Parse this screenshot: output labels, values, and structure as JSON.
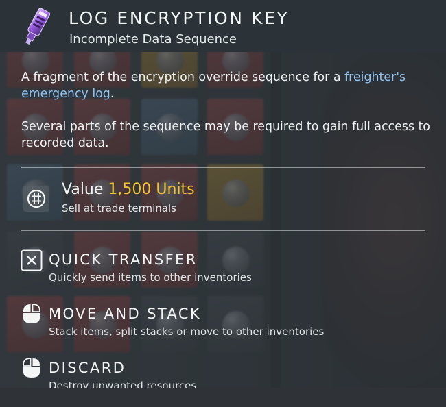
{
  "item": {
    "title": "LOG ENCRYPTION KEY",
    "subtitle": "Incomplete Data Sequence",
    "icon": "encryption-key-icon"
  },
  "description": {
    "p1_text": "A fragment of the encryption override sequence for a ",
    "p1_link": "freighter's emergency log",
    "p1_end": ".",
    "p2": "Several parts of the sequence may be required to gain full access to recorded data."
  },
  "value": {
    "label": "Value",
    "amount": "1,500 Units",
    "sub": "Sell at trade terminals",
    "icon": "units-currency-icon"
  },
  "actions": [
    {
      "title": "QUICK TRANSFER",
      "sub": "Quickly send items to other inventories",
      "icon": "x-key-icon"
    },
    {
      "title": "MOVE AND STACK",
      "sub": "Stack items, split stacks or move to other inventories",
      "icon": "left-mouse-button-icon"
    },
    {
      "title": "DISCARD",
      "sub": "Destroy unwanted resources",
      "icon": "right-mouse-button-icon"
    }
  ],
  "colors": {
    "accent_value": "#f6c32b",
    "link": "#8fc2f0",
    "header_bg": "#2b3338",
    "icon_purple": "#9b5de5"
  }
}
